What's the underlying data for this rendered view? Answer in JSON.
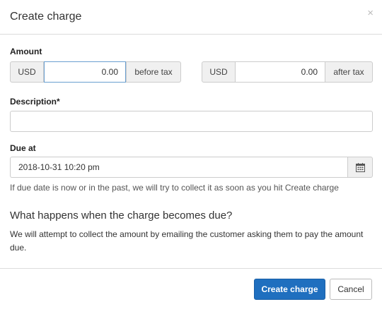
{
  "modal": {
    "title": "Create charge",
    "close_glyph": "×"
  },
  "amount": {
    "label": "Amount",
    "before_tax": {
      "currency": "USD",
      "value": "0.00",
      "suffix": "before tax"
    },
    "after_tax": {
      "currency": "USD",
      "value": "0.00",
      "suffix": "after tax"
    }
  },
  "description": {
    "label": "Description*",
    "value": ""
  },
  "due_at": {
    "label": "Due at",
    "value": "2018-10-31 10:20 pm",
    "calendar_icon": "calendar-icon",
    "help": "If due date is now or in the past, we will try to collect it as soon as you hit Create charge"
  },
  "info": {
    "heading": "What happens when the charge becomes due?",
    "body": "We will attempt to collect the amount by emailing the customer asking them to pay the amount due."
  },
  "footer": {
    "primary_label": "Create charge",
    "cancel_label": "Cancel"
  },
  "colors": {
    "primary": "#1f6fbf",
    "border": "#cccccc",
    "addon_bg": "#f0f0f0"
  }
}
